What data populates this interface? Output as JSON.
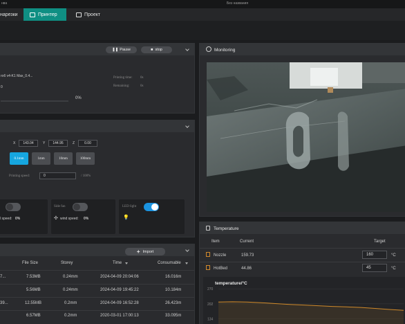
{
  "titlebar": {
    "left_text": "нва",
    "center_text": "Без названия"
  },
  "tabs": [
    {
      "label": "нарезки"
    },
    {
      "label": "Принтер"
    },
    {
      "label": "Проект"
    }
  ],
  "colors": {
    "accent": "#0f8f83",
    "toggle_on": "#1a93e0",
    "temp_curve": "#d08a2a",
    "selected_step": "#16a6df"
  },
  "print_panel": {
    "pause_label": "Pause",
    "stop_label": "stop",
    "file_name": "ro6 v4-K1 Max_0.4...",
    "file_sub": "0",
    "progress_percent": "0%",
    "progress_value": 0,
    "printing_time_label": "Printing time:",
    "printing_time_value": "0s",
    "remaining_label": "Remaining:",
    "remaining_value": "0s"
  },
  "control_panel": {
    "x_label": "X",
    "x_value": "143.04",
    "y_label": "Y",
    "y_value": "144.95",
    "z_label": "Z",
    "z_value": "0.00",
    "steps": [
      "0.1mm",
      "1mm",
      "10mm",
      "100mm"
    ],
    "printing_speed_label": "Printing speed:",
    "printing_speed_value": "0",
    "printing_speed_unit": "/ 100%"
  },
  "fans": {
    "card1_wind_label": "l speed:",
    "card1_wind_value": "0%",
    "card2_label": "Side fan",
    "card2_wind_label": "wind speed:",
    "card2_wind_value": "0%",
    "card3_label": "LED light",
    "card1_on": false,
    "card2_on": false,
    "card3_on": true
  },
  "files_panel": {
    "import_label": "Import",
    "columns": [
      "File Size",
      "Storey",
      "Time",
      "Consumable"
    ],
    "rows": [
      {
        "name": "7...",
        "size": "7.53MB",
        "storey": "0.24mm",
        "time": "2024-04-09 20:04:06",
        "consumable": "16.016m"
      },
      {
        "name": "",
        "size": "5.56MB",
        "storey": "0.24mm",
        "time": "2024-04-09 19:45:22",
        "consumable": "10.184m"
      },
      {
        "name": "39...",
        "size": "12.55MB",
        "storey": "0.2mm",
        "time": "2024-04-09 16:52:28",
        "consumable": "26.423m"
      },
      {
        "name": "",
        "size": "6.57MB",
        "storey": "0.2mm",
        "time": "2020-03-01 17:00:13",
        "consumable": "33.095m"
      }
    ]
  },
  "monitoring": {
    "title": "Monitoring"
  },
  "temperature": {
    "title": "Temperature",
    "col_item": "Item",
    "col_current": "Current",
    "col_target": "Target",
    "nozzle_label": "Nozzle",
    "nozzle_current": "159.73",
    "nozzle_target": "160",
    "nozzle_unit": "°C",
    "hotbed_label": "HotBed",
    "hotbed_current": "44.86",
    "hotbed_target": "45",
    "hotbed_unit": "°C",
    "chart_title": "temperature/°C"
  },
  "chart_data": {
    "type": "line",
    "title": "temperature/°C",
    "y_ticks": [
      "270",
      "202",
      "134"
    ],
    "ylim": [
      110,
      280
    ],
    "series": [
      {
        "values": [
          210,
          211,
          210,
          207,
          203,
          199,
          196,
          193,
          190,
          188,
          185,
          181,
          176,
          172
        ]
      }
    ]
  }
}
